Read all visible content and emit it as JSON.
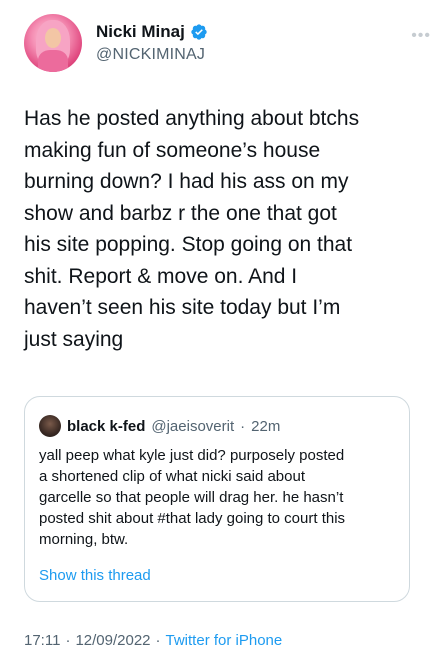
{
  "author": {
    "display_name": "Nicki Minaj",
    "handle": "@NICKIMINAJ",
    "verified": true
  },
  "more_icon": "more-dots-icon",
  "tweet": {
    "text": "Has he posted anything about btchs\nmaking fun of someone’s house\nburning down? I had his ass on my\nshow and barbz r the one that got\nhis site popping. Stop going on that\nshit. Report & move on. And I\nhaven’t seen his site today but I’m\njust saying"
  },
  "quote": {
    "author_name": "black k-fed",
    "author_handle": "@jaeisoverit",
    "separator": "·",
    "time": "22m",
    "text": "yall peep what kyle just did? purposely posted\na shortened clip of what nicki said about\ngarcelle so that people will drag her. he hasn’t\nposted shit about #that lady going to court this\nmorning, btw.",
    "show_thread_label": "Show this thread"
  },
  "footer": {
    "time": "17:11",
    "separator1": "·",
    "date": "12/09/2022",
    "separator2": "·",
    "source": "Twitter for iPhone"
  },
  "colors": {
    "text": "#0f1419",
    "secondary": "#536471",
    "accent": "#1d9bf0",
    "border": "#cfd9de"
  }
}
